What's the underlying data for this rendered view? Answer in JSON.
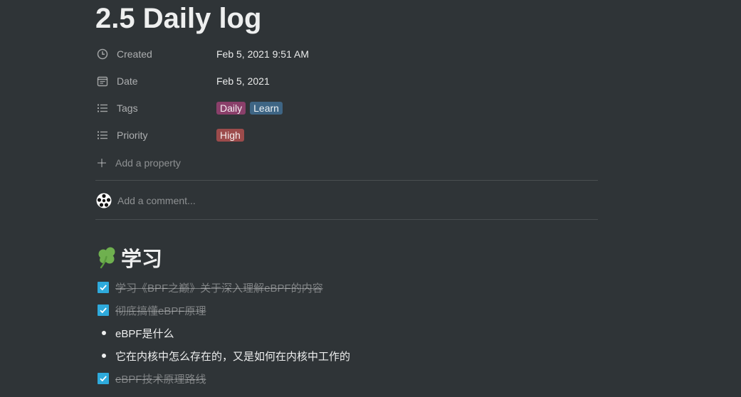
{
  "page": {
    "title": "2.5 Daily log"
  },
  "properties": [
    {
      "name": "Created",
      "icon": "clock-icon",
      "value": "Feb 5, 2021 9:51 AM"
    },
    {
      "name": "Date",
      "icon": "calendar-icon",
      "value": "Feb 5, 2021"
    },
    {
      "name": "Tags",
      "icon": "list-icon",
      "tags": [
        {
          "label": "Daily",
          "color": "#8a3f6a"
        },
        {
          "label": "Learn",
          "color": "#3e6584"
        }
      ]
    },
    {
      "name": "Priority",
      "icon": "list-icon",
      "tags": [
        {
          "label": "High",
          "color": "#9c4b4b"
        }
      ]
    }
  ],
  "add_property_label": "Add a property",
  "comment": {
    "placeholder": "Add a comment..."
  },
  "section": {
    "emoji": "shamrock-icon",
    "heading": "学习"
  },
  "items": [
    {
      "type": "todo",
      "checked": true,
      "text": "学习《BPF之巅》关于深入理解eBPF的内容"
    },
    {
      "type": "todo",
      "checked": true,
      "text": "彻底搞懂eBPF原理"
    },
    {
      "type": "bullet",
      "text": "eBPF是什么"
    },
    {
      "type": "bullet",
      "text": "它在内核中怎么存在的，又是如何在内核中工作的"
    },
    {
      "type": "todo",
      "checked": true,
      "text": "eBPF技术原理路线"
    }
  ],
  "colors": {
    "background": "#2f3437",
    "checkbox": "#2eaadc"
  }
}
